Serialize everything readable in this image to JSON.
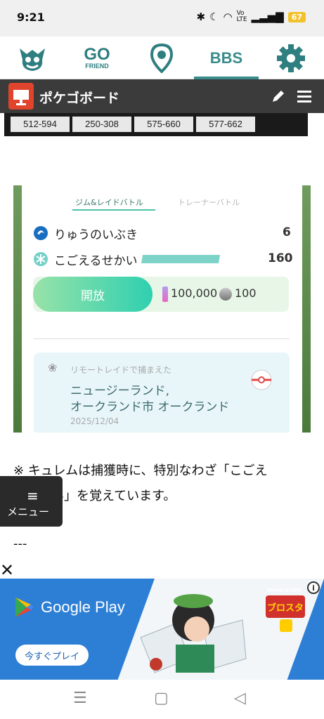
{
  "status_bar": {
    "time": "9:21",
    "battery": "67"
  },
  "top_nav": {
    "go_friend": {
      "line1": "GO",
      "line2": "FRIEND"
    },
    "bbs_label": "BBS"
  },
  "header": {
    "title": "ポケゴボード"
  },
  "stat_strip": {
    "cells": [
      "512-594",
      "250-308",
      "575-660",
      "577-662"
    ]
  },
  "screenshot": {
    "tabs": {
      "active": "ジム&レイドバトル",
      "inactive": "トレーナーバトル"
    },
    "moves": [
      {
        "name": "りゅうのいぶき",
        "value": "6"
      },
      {
        "name": "こごえるせかい",
        "value": "160"
      }
    ],
    "unlock": {
      "button": "開放",
      "stardust": "100,000",
      "candy": "100"
    },
    "location": {
      "caption": "リモートレイドで捕まえた",
      "line1": "ニュージーランド,",
      "line2": "オークランド市 オークランド",
      "date": "2025/12/04"
    }
  },
  "article": {
    "note_line1": "※ キュレムは捕獲時に、特別なわざ「こごえ",
    "note_line2": "るせかい」を覚えています。",
    "separator": "---"
  },
  "menu": {
    "label": "メニュー"
  },
  "ad": {
    "store": "Google Play",
    "cta": "今すぐプレイ",
    "game_logo": "ブロスタ",
    "game_logo_top": "BRAWLSTARS"
  },
  "colors": {
    "accent": "#3a8b8b",
    "header_bg": "#3b3b3b",
    "logo_red": "#e0442c",
    "ad_blue": "#2d7fd6"
  }
}
